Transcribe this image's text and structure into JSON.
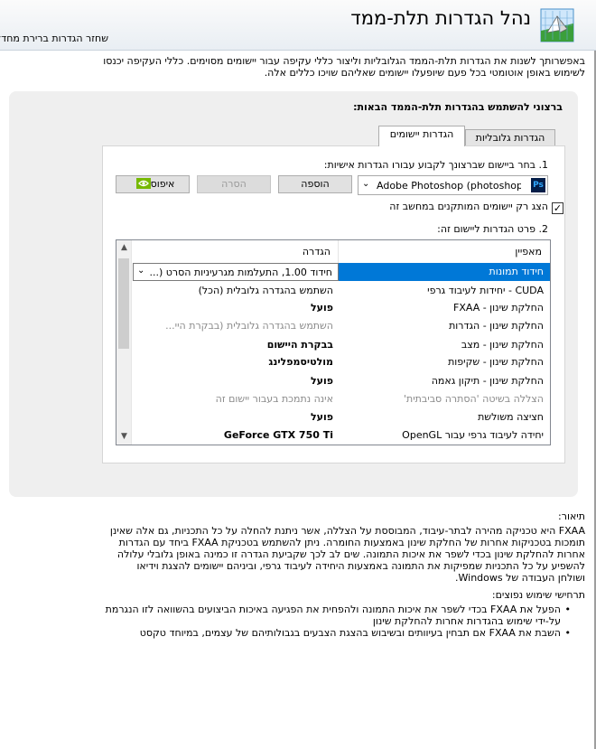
{
  "header": {
    "title": "נהל הגדרות תלת-ממד",
    "restore_link": "שחזר הגדרות ברירת מחדל"
  },
  "intro": {
    "line1": "באפשרותך לשנות את הגדרות תלת-הממד הגלובליות וליצור כללי עקיפה עבור יישומים מסוימים. כללי העקיפה יכנסו",
    "line2": "לשימוש באופן אוטומטי בכל פעם שיופעלו יישומים שאליהם שויכו כללים אלה."
  },
  "panel": {
    "heading": "ברצוני להשתמש בהגדרות תלת-הממד הבאות:",
    "tabs": [
      {
        "label": "הגדרות גלובליות",
        "active": false
      },
      {
        "label": "הגדרות יישומים",
        "active": true
      }
    ],
    "step1_label": "1. בחר ביישום שברצונך לקבוע עבורו הגדרות אישיות:",
    "program": {
      "icon_text": "Ps",
      "selected": "Adobe Photoshop (photoshop...."
    },
    "buttons": {
      "add": "הוספה",
      "remove": "הסרה",
      "restore": "איפוס"
    },
    "checkbox": {
      "label": "הצג רק יישומים המותקנים במחשב זה",
      "checked": true
    },
    "step2_label": "2. פרט הגדרות ליישום זה:",
    "grid": {
      "col_feature": "מאפיין",
      "col_setting": "הגדרה",
      "rows": [
        {
          "feature": "חידוד תמונות",
          "setting": "חידוד 1.00, התעלמות מגרעיניות הסרט (...",
          "style": "normal",
          "selected": true
        },
        {
          "feature": "CUDA - יחידות לעיבוד גרפי",
          "setting": "השתמש בהגדרה גלובלית (הכל)",
          "style": "normal",
          "selected": false
        },
        {
          "feature": "החלקת שינון - FXAA",
          "setting": "פועל",
          "style": "bold",
          "selected": false
        },
        {
          "feature": "החלקת שינון - הגדרות",
          "setting": "השתמש בהגדרה גלובלית (בבקרת היי...",
          "style": "gray",
          "selected": false
        },
        {
          "feature": "החלקת שינון - מצב",
          "setting": "בבקרת היישום",
          "style": "bold",
          "selected": false
        },
        {
          "feature": "החלקת שינון - שקיפות",
          "setting": "מולטיסמפלינג",
          "style": "bold",
          "selected": false
        },
        {
          "feature": "החלקת שינון - תיקון גאמה",
          "setting": "פועל",
          "style": "bold",
          "selected": false
        },
        {
          "feature": "הצללה בשיטה 'הסתרה סביבתית'",
          "setting": "אינה נתמכת בעבור יישום זה",
          "style": "gray",
          "selected": false
        },
        {
          "feature": "חציצה משולשת",
          "setting": "פועל",
          "style": "bold",
          "selected": false
        },
        {
          "feature": "יחידה לעיבוד גרפי עבור OpenGL",
          "setting": "GeForce GTX 750 Ti",
          "style": "bold",
          "selected": false
        }
      ]
    }
  },
  "description": {
    "heading": "תיאור:",
    "lines": [
      "FXAA היא טכניקה מהירה לבתר-עיבוד, המבוססת על הצללה, אשר ניתנת להחלה על כל התכניות, גם אלה שאינן",
      "תומכות בטכניקות אחרות של החלקת שינון באמצעות החומרה. ניתן להשתמש בטכניקת FXAA ביחד עם הגדרות",
      "אחרות להחלקת שינון בכדי לשפר את איכות התמונה. שים לב לכך שקביעת הגדרה זו כמינה באופן גלובלי עלולה",
      "להשפיע על כל התכניות שמפיקות את התמונה באמצעות היחידה לעיבוד גרפי, וביניהם יישומים להצגת וידיאו",
      "ושולחן העבודה של Windows."
    ],
    "usage_heading": "תרחישי שימוש נפוצים:",
    "usage_items": [
      {
        "line1": "הפעל את FXAA בכדי לשפר את איכות התמונה ולהפחית את הפגיעה באיכות הביצועים בהשוואה לזו הנגרמת",
        "line2": "על-ידי שימוש בהגדרות אחרות להחלקת שינון"
      },
      {
        "line1": "השבת את FXAA אם תבחין בעיוותים ובשיבוש בהצגת הצבעים בגבולותיהם של עצמים, במיוחד טקסט",
        "line2": ""
      }
    ]
  },
  "colors": {
    "selection": "#0078d7",
    "nvidia_green": "#76b900"
  }
}
